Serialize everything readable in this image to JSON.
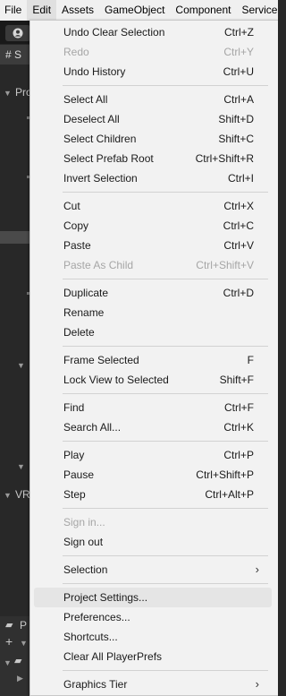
{
  "menubar": {
    "items": [
      "File",
      "Edit",
      "Assets",
      "GameObject",
      "Component",
      "Services"
    ]
  },
  "editor": {
    "scene_tab_glyph": "#",
    "scene_tab_text": "S",
    "tree": {
      "proj_label": "Pro",
      "vr_label": "VR",
      "bottom_label": "P"
    }
  },
  "edit_menu": {
    "items": [
      {
        "label": "Undo Clear Selection",
        "shortcut": "Ctrl+Z"
      },
      {
        "label": "Redo",
        "shortcut": "Ctrl+Y",
        "disabled": true
      },
      {
        "label": "Undo History",
        "shortcut": "Ctrl+U"
      },
      {
        "label": "Select All",
        "shortcut": "Ctrl+A"
      },
      {
        "label": "Deselect All",
        "shortcut": "Shift+D"
      },
      {
        "label": "Select Children",
        "shortcut": "Shift+C"
      },
      {
        "label": "Select Prefab Root",
        "shortcut": "Ctrl+Shift+R"
      },
      {
        "label": "Invert Selection",
        "shortcut": "Ctrl+I"
      },
      {
        "label": "Cut",
        "shortcut": "Ctrl+X"
      },
      {
        "label": "Copy",
        "shortcut": "Ctrl+C"
      },
      {
        "label": "Paste",
        "shortcut": "Ctrl+V"
      },
      {
        "label": "Paste As Child",
        "shortcut": "Ctrl+Shift+V",
        "disabled": true
      },
      {
        "label": "Duplicate",
        "shortcut": "Ctrl+D"
      },
      {
        "label": "Rename",
        "shortcut": ""
      },
      {
        "label": "Delete",
        "shortcut": ""
      },
      {
        "label": "Frame Selected",
        "shortcut": "F"
      },
      {
        "label": "Lock View to Selected",
        "shortcut": "Shift+F"
      },
      {
        "label": "Find",
        "shortcut": "Ctrl+F"
      },
      {
        "label": "Search All...",
        "shortcut": "Ctrl+K"
      },
      {
        "label": "Play",
        "shortcut": "Ctrl+P"
      },
      {
        "label": "Pause",
        "shortcut": "Ctrl+Shift+P"
      },
      {
        "label": "Step",
        "shortcut": "Ctrl+Alt+P"
      },
      {
        "label": "Sign in...",
        "shortcut": "",
        "disabled": true
      },
      {
        "label": "Sign out",
        "shortcut": ""
      },
      {
        "label": "Selection",
        "shortcut": "",
        "submenu": true
      },
      {
        "label": "Project Settings...",
        "shortcut": "",
        "hovered": true
      },
      {
        "label": "Preferences...",
        "shortcut": ""
      },
      {
        "label": "Shortcuts...",
        "shortcut": ""
      },
      {
        "label": "Clear All PlayerPrefs",
        "shortcut": ""
      },
      {
        "label": "Graphics Tier",
        "shortcut": "",
        "submenu": true
      }
    ],
    "submenu_arrow": "›"
  }
}
